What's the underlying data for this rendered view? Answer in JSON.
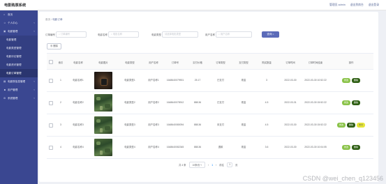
{
  "app": {
    "title": "电影购票系统"
  },
  "top_links": [
    "管理员 admin",
    "退出到前台",
    "退出登录"
  ],
  "sidebar": {
    "items": [
      {
        "label": "首页",
        "icon": "home-icon",
        "active": false,
        "sub": false
      },
      {
        "label": "个人中心",
        "icon": "user-icon",
        "active": false,
        "sub": false,
        "expandable": true
      },
      {
        "label": "电影管理",
        "icon": "film-icon",
        "active": false,
        "sub": false,
        "expandable": true
      },
      {
        "label": "电影管理",
        "icon": "",
        "active": false,
        "sub": true
      },
      {
        "label": "电影类型管理",
        "icon": "",
        "active": false,
        "sub": true
      },
      {
        "label": "电影评论管理",
        "icon": "",
        "active": false,
        "sub": true
      },
      {
        "label": "电影资讯管理",
        "icon": "",
        "active": false,
        "sub": true
      },
      {
        "label": "电影订单管理",
        "icon": "",
        "active": true,
        "sub": true
      },
      {
        "label": "电影院信息管理",
        "icon": "cinema-icon",
        "active": false,
        "sub": false,
        "expandable": true
      },
      {
        "label": "用户管理",
        "icon": "users-icon",
        "active": false,
        "sub": false,
        "expandable": true
      },
      {
        "label": "系统管理",
        "icon": "gear-icon",
        "active": false,
        "sub": false,
        "expandable": true
      }
    ]
  },
  "breadcrumb": {
    "home": "首页",
    "current": "电影订单"
  },
  "search": {
    "fields": [
      {
        "label": "订单编号",
        "placeholder": "订单编号"
      },
      {
        "label": "电影名称",
        "placeholder": "电影名称"
      },
      {
        "label": "电影类型",
        "placeholder": "请选择电影类型"
      },
      {
        "label": "用户名称",
        "placeholder": "用户名称"
      }
    ],
    "button": "查询"
  },
  "toolbar": {
    "delete_label": "删除"
  },
  "table": {
    "columns": [
      "",
      "索引",
      "电影名称",
      "电影图片",
      "电影类型",
      "用户名称",
      "订单号",
      "实付价格",
      "订单类型",
      "支付类型",
      "购买数量",
      "订单时间",
      "订单时间结束",
      "操作"
    ],
    "rows": [
      {
        "index": "1",
        "movie": "电影名称1",
        "image": "thumb1",
        "type": "电影类型1",
        "user": "用户名称1",
        "order_no": "1648640079901",
        "price": "25.17",
        "order_type": "已支付",
        "pay_type": "现金",
        "qty": "3",
        "time": "2022-03-30",
        "time_end": "2022-03-30 10:52:22",
        "ops": [
          "修改",
          "删除"
        ]
      },
      {
        "index": "2",
        "movie": "电影名称2",
        "image": "thumb2",
        "type": "电影类型2",
        "user": "用户名称2",
        "order_no": "1648640078912",
        "price": "888.36",
        "order_type": "已支付",
        "pay_type": "现金",
        "qty": "4.5",
        "time": "2022-03-31",
        "time_end": "2022-03-30 15:52:22",
        "ops": [
          "修改",
          "删除"
        ]
      },
      {
        "index": "3",
        "movie": "电影名称3",
        "image": "thumb2",
        "type": "电影类型3",
        "user": "用户名称3",
        "order_no": "1648640080094",
        "price": "888.36",
        "order_type": "未支付",
        "pay_type": "现金",
        "qty": "4.5",
        "time": "2022-03-30",
        "time_end": "2022-03-30 15:52:22",
        "ops": [
          "修改",
          "删除",
          "支付"
        ]
      },
      {
        "index": "4",
        "movie": "电影名称4",
        "image": "thumb2",
        "type": "电影类型4",
        "user": "用户名称4",
        "order_no": "1648640082345",
        "price": "888.36",
        "order_type": "退款",
        "pay_type": "现金",
        "qty": "3.6",
        "time": "2022-03-30",
        "time_end": "2022-03-30 10:04:05",
        "ops": [
          "修改",
          "删除"
        ]
      }
    ]
  },
  "pagination": {
    "total": "共 4 条",
    "page_size": "10条/页",
    "prev": "‹",
    "current": "1",
    "next": "›",
    "goto_prefix": "前往",
    "goto_value": "1",
    "goto_suffix": "页"
  },
  "watermark": "CSDN @wei_chen_q123456"
}
